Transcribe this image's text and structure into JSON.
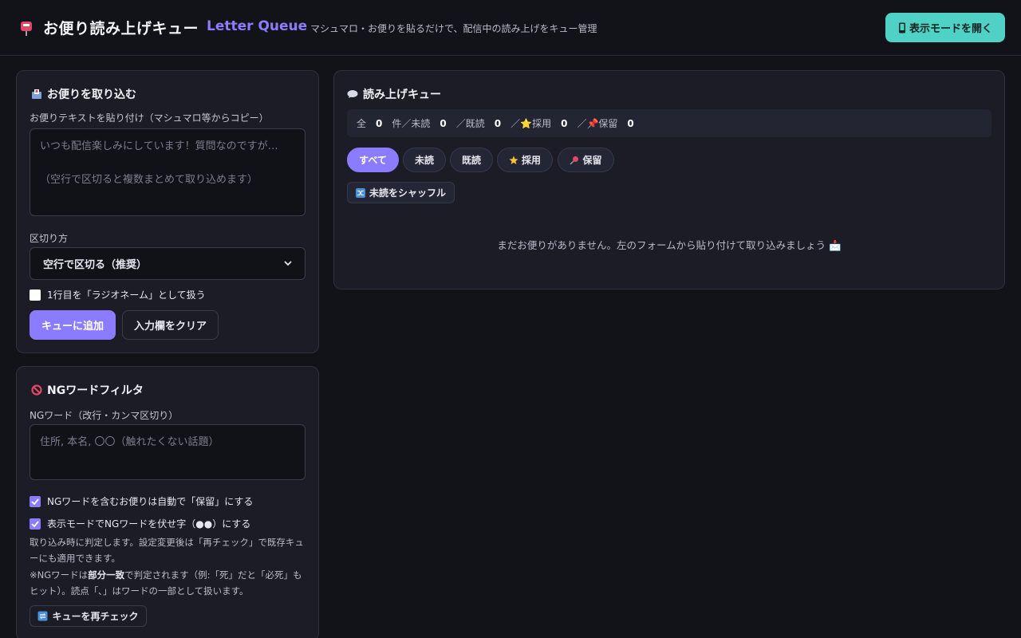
{
  "header": {
    "title": "お便り読み上げキュー",
    "subtitle": "Letter Queue",
    "tagline": "マシュマロ・お便りを貼るだけで、配信中の読み上げをキュー管理",
    "display_button": "表示モードを開く",
    "colors": {
      "accent": "#8b7cff",
      "teal": "#4fd1c5"
    }
  },
  "import_panel": {
    "title": "お便りを取り込む",
    "text_label": "お便りテキストを貼り付け（マシュマロ等からコピー）",
    "text_placeholder": "いつも配信楽しみにしています！質問なのですが…\n\n（空行で区切ると複数まとめて取り込めます）",
    "split_label": "区切り方",
    "split_selected": "空行で区切る（推奨）",
    "radio_name_checkbox": "1行目を「ラジオネーム」として扱う",
    "add_button": "キューに追加",
    "clear_button": "入力欄をクリア"
  },
  "ng_panel": {
    "title": "NGワードフィルタ",
    "words_label": "NGワード（改行・カンマ区切り）",
    "words_placeholder": "住所, 本名, 〇〇（触れたくない話題）",
    "auto_hold_checkbox": "NGワードを含むお便りは自動で「保留」にする",
    "mask_checkbox": "表示モードでNGワードを伏せ字（●●）にする",
    "note1": "取り込み時に判定します。設定変更後は「再チェック」で既存キューにも適用できます。",
    "note2_prefix": "※NGワードは",
    "note2_bold": "部分一致",
    "note2_suffix": "で判定されます（例:「死」だと「必死」もヒット）。読点「､」はワードの一部として扱います。",
    "recheck_button": "キューを再チェック"
  },
  "queue_panel": {
    "title": "読み上げキュー",
    "stats": {
      "total_label": "全",
      "total": "0",
      "unit": "件／未読",
      "unread": "0",
      "read_label": "／既読",
      "read": "0",
      "adopted_label": "／⭐採用",
      "adopted": "0",
      "hold_label": "／📌保留",
      "hold": "0"
    },
    "filters": [
      "すべて",
      "未読",
      "既読",
      "採用",
      "保留"
    ],
    "shuffle_button": "未読をシャッフル",
    "empty_message": "まだお便りがありません。左のフォームから貼り付けて取り込みましょう 📩"
  }
}
